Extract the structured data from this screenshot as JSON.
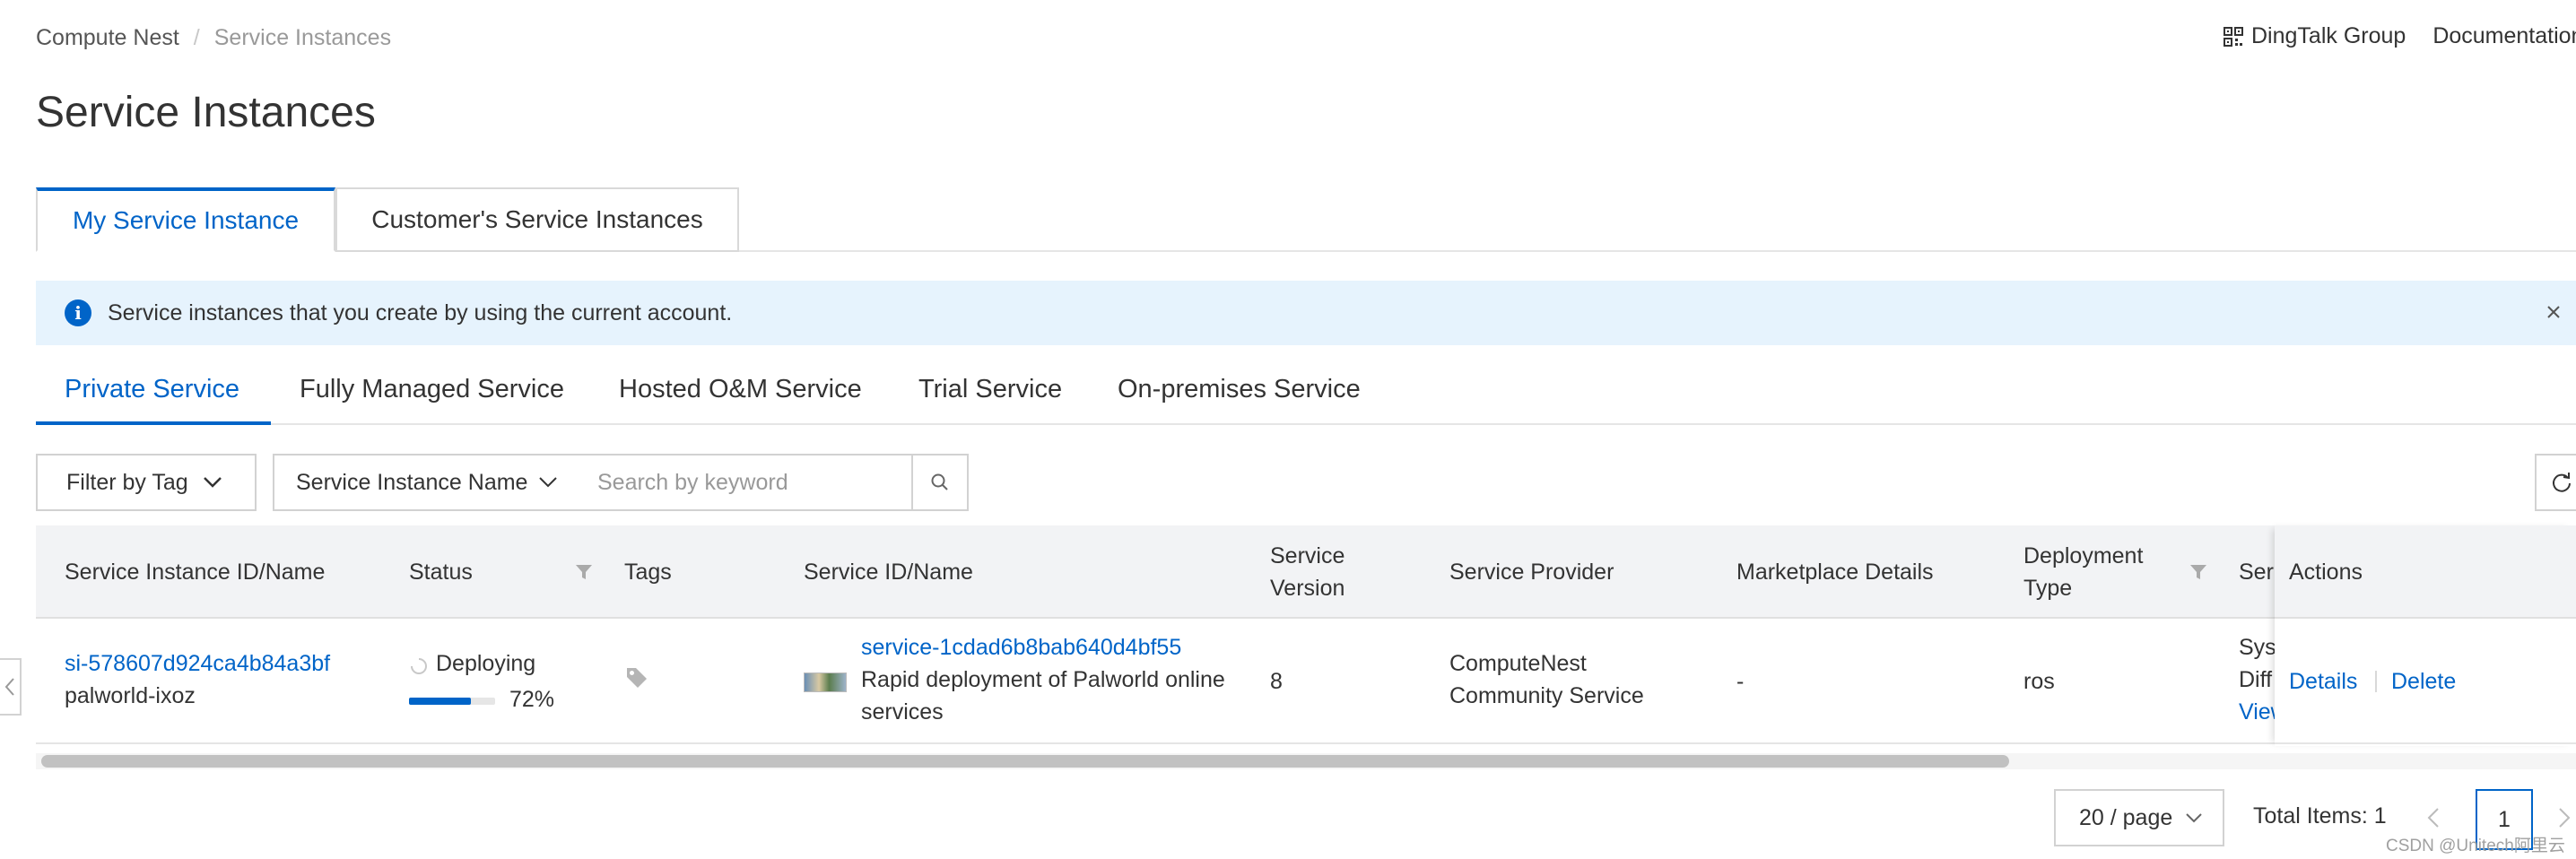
{
  "breadcrumb": {
    "root": "Compute Nest",
    "separator": "/",
    "current": "Service Instances"
  },
  "top_links": {
    "dingtalk": "DingTalk Group",
    "documentation": "Documentation"
  },
  "page_title": "Service Instances",
  "primary_tabs": [
    {
      "label": "My Service Instance",
      "active": true
    },
    {
      "label": "Customer's Service Instances",
      "active": false
    }
  ],
  "notice": {
    "text": "Service instances that you create by using the current account."
  },
  "secondary_tabs": [
    {
      "label": "Private Service",
      "active": true
    },
    {
      "label": "Fully Managed Service"
    },
    {
      "label": "Hosted O&M Service"
    },
    {
      "label": "Trial Service"
    },
    {
      "label": "On-premises Service"
    }
  ],
  "toolbar": {
    "filter_by_tag": "Filter by Tag",
    "search_field_select": "Service Instance Name",
    "search_placeholder": "Search by keyword"
  },
  "table": {
    "headers": {
      "instance": "Service Instance ID/Name",
      "status": "Status",
      "tags": "Tags",
      "service": "Service ID/Name",
      "version_l1": "Service",
      "version_l2": "Version",
      "provider": "Service Provider",
      "marketplace": "Marketplace Details",
      "deploy_l1": "Deployment",
      "deploy_l2": "Type",
      "ser_truncated": "Ser",
      "actions": "Actions"
    },
    "rows": [
      {
        "instance_id": "si-578607d924ca4b84a3bf",
        "instance_name": "palworld-ixoz",
        "status": "Deploying",
        "progress_percent": 72,
        "progress_label": "72%",
        "service_id": "service-1cdad6b8bab640d4bf55",
        "service_desc_l1": "Rapid deployment of Palworld online",
        "service_desc_l2": "services",
        "version": "8",
        "provider_l1": "ComputeNest",
        "provider_l2": "Community Service",
        "marketplace": "-",
        "deployment_type": "ros",
        "ser_l1": "Sys",
        "ser_l2": "Diff",
        "ser_l3": "View",
        "action_details": "Details",
        "action_delete": "Delete"
      }
    ]
  },
  "pagination": {
    "page_size": "20 / page",
    "total": "Total Items: 1",
    "current_page": "1"
  },
  "watermark": "CSDN @Unitech阿里云",
  "colors": {
    "primary": "#0064c8",
    "notice_bg": "#e6f3fd",
    "header_bg": "#f2f3f5"
  }
}
